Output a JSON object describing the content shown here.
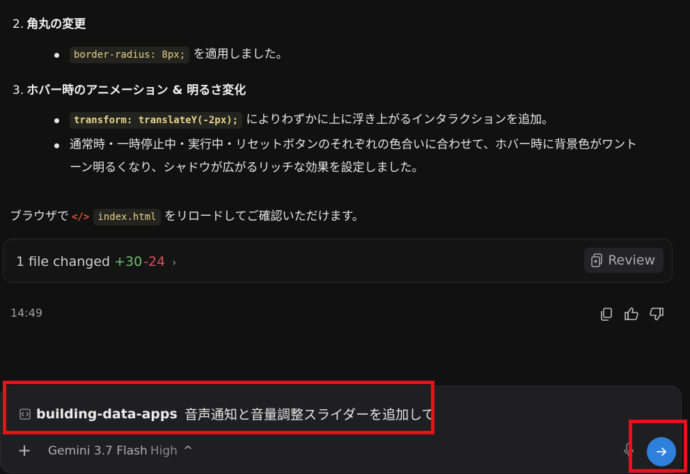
{
  "sections": [
    {
      "number": "2.",
      "title": "角丸の変更"
    },
    {
      "number": "3.",
      "title": "ホバー時のアニメーション & 明るさ変化"
    }
  ],
  "bullets": {
    "radius_code": "border-radius: 8px;",
    "radius_text": "を適用しました。",
    "transform_code": "transform: translateY(-2px);",
    "transform_text": "によりわずかに上に浮き上がるインタラクションを追加。",
    "hover_line1": "通常時・一時停止中・実行中・リセットボタンのそれぞれの色合いに合わせて、ホバー時に背景色がワント",
    "hover_line2": "ーン明るくなり、シャドウが広がるリッチな効果を設定しました。"
  },
  "paragraph": {
    "prefix": "ブラウザで",
    "icon_glyph": "</>",
    "file": "index.html",
    "suffix": "をリロードしてご確認いただけます。"
  },
  "changes": {
    "label": "1 file changed",
    "added": "+30",
    "removed": "-24",
    "chevron": "›",
    "review_label": "Review"
  },
  "message": {
    "time": "14:49"
  },
  "composer": {
    "project": "building-data-apps",
    "text": "音声通知と音量調整スライダーを追加して",
    "plus": "+",
    "model": "Gemini 3.7 Flash",
    "tier": "High",
    "caret": "^"
  },
  "colors": {
    "accent": "#2f7fdc",
    "added": "#6fbf6a",
    "removed": "#e0505e",
    "highlight": "#e1141c"
  },
  "icons": [
    "code-icon",
    "html-icon",
    "review-icon",
    "copy-icon",
    "thumbs-up-icon",
    "thumbs-down-icon",
    "microphone-icon",
    "arrow-right-icon"
  ]
}
